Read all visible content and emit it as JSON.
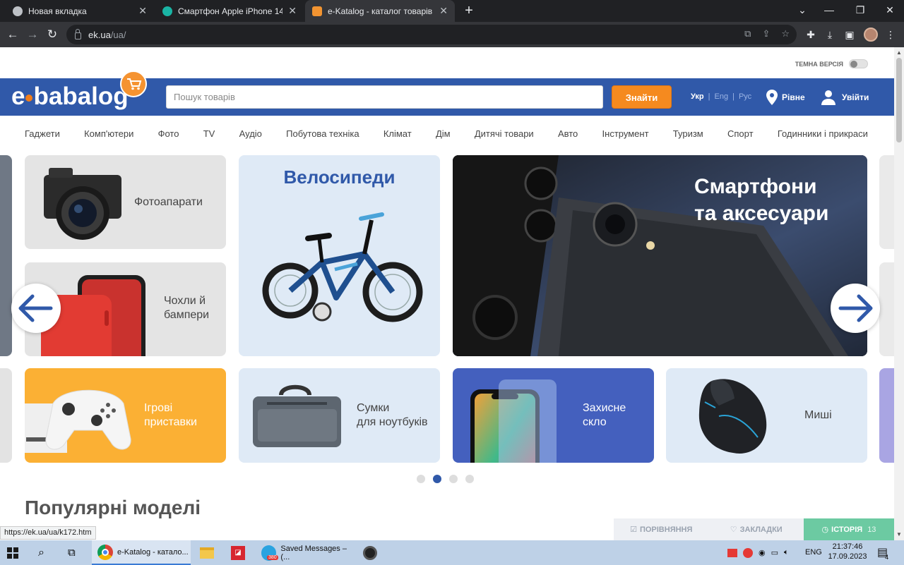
{
  "browser": {
    "tabs": [
      {
        "title": "Новая вкладка",
        "active": false
      },
      {
        "title": "Смартфон Apple iPhone 14 Pro",
        "active": false
      },
      {
        "title": "e-Katalog - каталог товарів і цін",
        "active": true
      }
    ],
    "url_host": "ek.ua",
    "url_path": "/ua/"
  },
  "page": {
    "dark_mode_label": "ТЕМНА ВЕРСІЯ",
    "logo_text_pre": "e",
    "logo_text_post": "babalog",
    "search_placeholder": "Пошук товарів",
    "find_button": "Знайти",
    "languages": [
      "Укр",
      "Eng",
      "Рус"
    ],
    "city": "Рівне",
    "login": "Увійти",
    "categories": [
      "Гаджети",
      "Комп'ютери",
      "Фото",
      "TV",
      "Аудіо",
      "Побутова техніка",
      "Клімат",
      "Дім",
      "Дитячі товари",
      "Авто",
      "Інструмент",
      "Туризм",
      "Спорт",
      "Годинники і прикраси"
    ],
    "cards": {
      "cameras": "Фотоапарати",
      "cases_1": "Чохли й",
      "cases_2": "бампери",
      "bikes": "Велосипеди",
      "phones_1": "Смартфони",
      "phones_2": "та аксесуари",
      "consoles_1": "Ігрові",
      "consoles_2": "приставки",
      "bags_1": "Сумки",
      "bags_2": "для ноутбуків",
      "glass_1": "Захисне",
      "glass_2": "скло",
      "mice": "Миші"
    },
    "slider_active_dot": 2,
    "popular_heading": "Популярні моделі",
    "bottom_bar": {
      "compare": "ПОРІВНЯННЯ",
      "bookmarks": "ЗАКЛАДКИ",
      "history": "ІСТОРІЯ",
      "history_count": "13"
    },
    "status_url": "https://ek.ua/ua/k172.htm"
  },
  "taskbar": {
    "chrome_task": "e-Katalog - катало...",
    "telegram_task": "Saved Messages – (...",
    "telegram_badge": "380",
    "language": "ENG",
    "time": "21:37:46",
    "date": "17.09.2023",
    "notifications": "4"
  },
  "colors": {
    "brand_blue": "#3059a9",
    "accent_orange": "#f58a1f",
    "history_green": "#6ccaa2"
  }
}
